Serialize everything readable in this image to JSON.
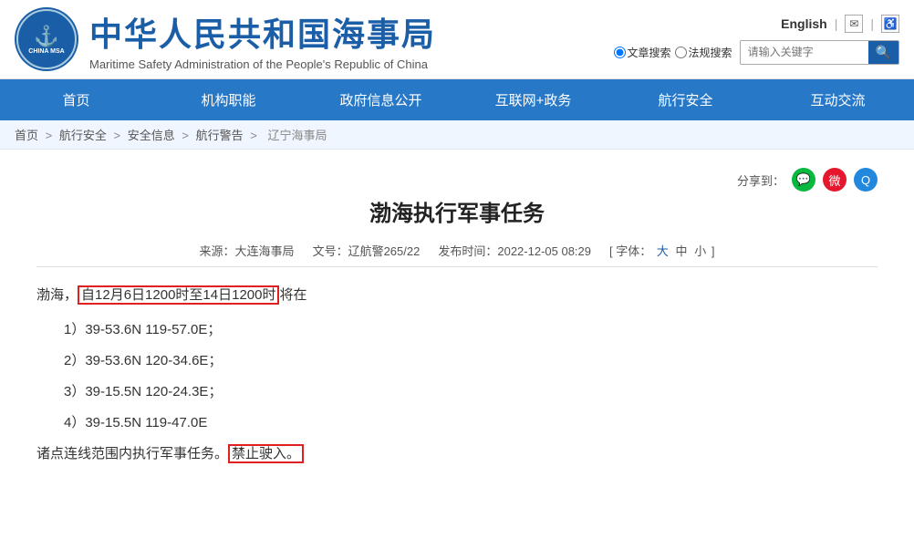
{
  "header": {
    "title_cn": "中华人民共和国海事局",
    "title_en": "Maritime Safety Administration of the People's Republic of China",
    "lang_link": "English",
    "search_placeholder": "请输入关键字",
    "radio1": "文章搜索",
    "radio2": "法规搜索"
  },
  "nav": {
    "items": [
      "首页",
      "机构职能",
      "政府信息公开",
      "互联网+政务",
      "航行安全",
      "互动交流"
    ]
  },
  "breadcrumb": {
    "items": [
      "首页",
      "航行安全",
      "安全信息",
      "航行警告",
      "辽宁海事局"
    ]
  },
  "article": {
    "title": "渤海执行军事任务",
    "source_label": "来源：",
    "source": "大连海事局",
    "doc_no_label": "文号：",
    "doc_no": "辽航警265/22",
    "date_label": "发布时间：",
    "date": "2022-12-05 08:29",
    "font_label": "字体：",
    "font_large": "大",
    "font_medium": "中",
    "font_small": "小",
    "share_label": "分享到：",
    "body_line1": "渤海，",
    "body_highlight1": "自12月6日1200时至14日1200时",
    "body_line1_end": "将在",
    "coord1": "1）39-53.6N    119-57.0E；",
    "coord2": "2）39-53.6N    120-34.6E；",
    "coord3": "3）39-15.5N    120-24.3E；",
    "coord4": "4）39-15.5N    119-47.0E",
    "body_line2": "诸点连线范围内执行军事任务。",
    "body_highlight2": "禁止驶入。"
  }
}
